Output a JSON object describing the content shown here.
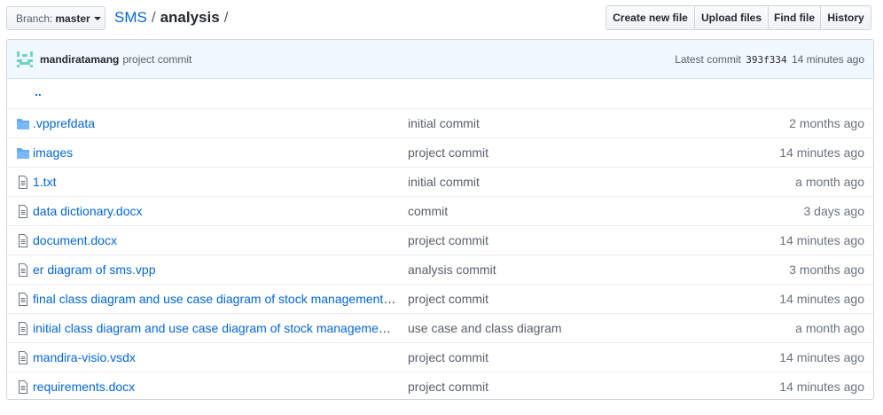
{
  "toolbar": {
    "branch_prefix": "Branch:",
    "branch_name": "master",
    "breadcrumb_repo": "SMS",
    "breadcrumb_sep1": "/",
    "breadcrumb_dir": "analysis",
    "breadcrumb_sep2": "/",
    "buttons": [
      "Create new file",
      "Upload files",
      "Find file",
      "History"
    ]
  },
  "commit": {
    "author": "mandiratamang",
    "message": "project commit",
    "latest_label": "Latest commit",
    "sha": "393f334",
    "age": "14 minutes ago"
  },
  "parent_link": "..",
  "files": [
    {
      "type": "folder",
      "name": ".vpprefdata",
      "message": "initial commit",
      "age": "2 months ago"
    },
    {
      "type": "folder",
      "name": "images",
      "message": "project commit",
      "age": "14 minutes ago"
    },
    {
      "type": "file",
      "name": "1.txt",
      "message": "initial commit",
      "age": "a month ago"
    },
    {
      "type": "file",
      "name": "data dictionary.docx",
      "message": "commit",
      "age": "3 days ago"
    },
    {
      "type": "file",
      "name": "document.docx",
      "message": "project commit",
      "age": "14 minutes ago"
    },
    {
      "type": "file",
      "name": "er diagram of sms.vpp",
      "message": "analysis commit",
      "age": "3 months ago"
    },
    {
      "type": "file",
      "name": "final class diagram and use case diagram of stock management s…",
      "message": "project commit",
      "age": "14 minutes ago"
    },
    {
      "type": "file",
      "name": "initial class diagram and use case diagram of stock management …",
      "message": "use case and class diagram",
      "age": "a month ago"
    },
    {
      "type": "file",
      "name": "mandira-visio.vsdx",
      "message": "project commit",
      "age": "14 minutes ago"
    },
    {
      "type": "file",
      "name": "requirements.docx",
      "message": "project commit",
      "age": "14 minutes ago"
    }
  ],
  "colors": {
    "link": "#0366d6",
    "folder_icon": "#79b8ff",
    "file_icon": "#6a737d",
    "commit_bar_bg": "#f1f8ff"
  },
  "icons": {
    "folder": "folder-icon",
    "file": "file-icon",
    "branch_caret": "chevron-down-icon",
    "avatar": "identicon-avatar"
  }
}
